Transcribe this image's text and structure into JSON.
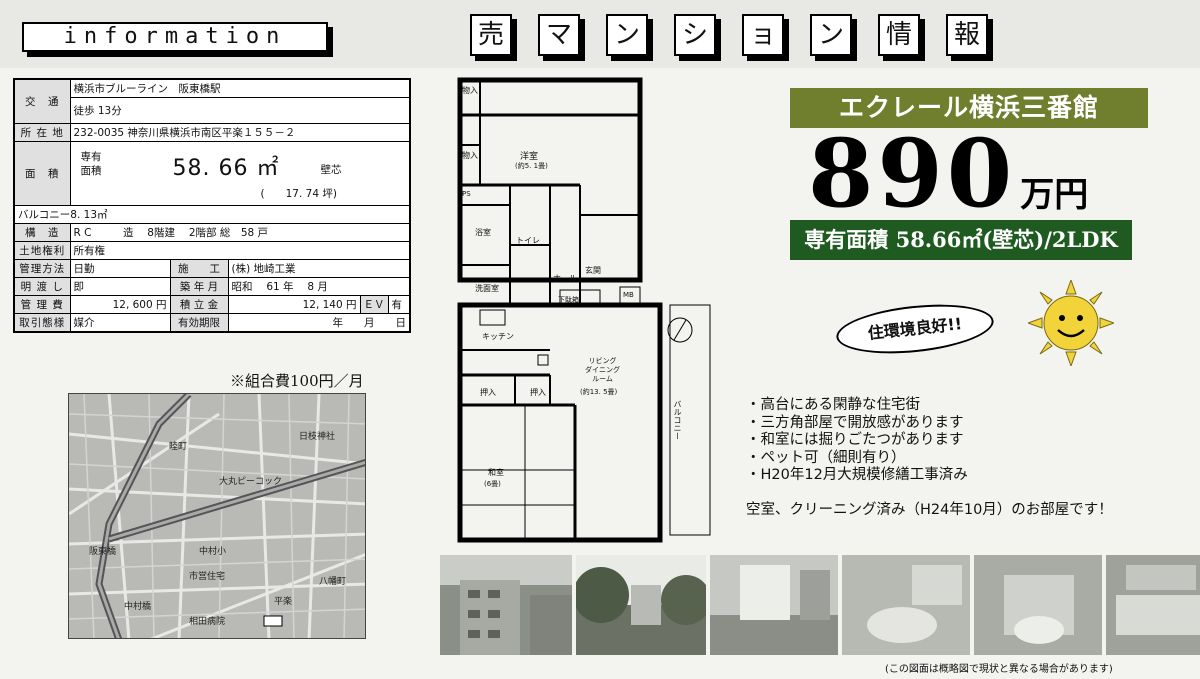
{
  "header": {
    "info_label": "information",
    "title_chars": [
      "売",
      "マ",
      "ン",
      "シ",
      "ョ",
      "ン",
      "情",
      "報"
    ]
  },
  "table": {
    "access_label": "交　通",
    "access_line1": "横浜市ブルーライン　阪東橋駅",
    "access_line2": "徒歩 13分",
    "address_label": "所 在 地",
    "address_value": "232-0035 神奈川県横浜市南区平楽１５５－２",
    "area_label": "面　積",
    "area_sub_label1": "専有",
    "area_sub_label2": "面積",
    "area_value": "58. 66 ㎡",
    "area_wall": "壁芯",
    "area_tsubo": "(　　17. 74 坪)",
    "balcony": "バルコニー8. 13㎡",
    "structure_label": "構　造",
    "structure_value": "R C　　　造　 8階建　 2階部 総　58 戸",
    "land_label": "土地権利",
    "land_value": "所有権",
    "mgmt_method_label": "管理方法",
    "mgmt_method_value": "日勤",
    "builder_label": "施　　工",
    "builder_value": "(株) 地崎工業",
    "handover_label": "明 渡 し",
    "handover_value": "即",
    "built_label": "築 年 月",
    "built_value": "昭和　 61 年　 8 月",
    "mgmt_fee_label": "管 理 費",
    "mgmt_fee_value": "12, 600 円",
    "reserve_label": "積 立 金",
    "reserve_value": "12, 140 円",
    "elevator_label": "ＥＶ",
    "elevator_value": "有",
    "deal_label": "取引態様",
    "deal_value": "媒介",
    "valid_label": "有効期限",
    "valid_value": "年　　月　　日"
  },
  "union_note": "※組合費100円／月",
  "map_labels": [
    "阪東橋",
    "大丸ピーコック",
    "中村小",
    "中村橋",
    "平楽",
    "日枝神社",
    "睦町",
    "市営住宅",
    "八幡町",
    "相田病院"
  ],
  "floorplan_labels": {
    "western_room": "洋室",
    "western_room_size": "(約5. 1畳)",
    "storage": "物入",
    "toilet": "トイレ",
    "bath": "浴室",
    "washroom": "洗面室",
    "hall": "ホール",
    "entrance": "玄関",
    "shoe_box": "下駄箱",
    "kitchen": "キッチン",
    "living": "リビング\nダイニング\nルーム",
    "living_size": "(約13. 5畳)",
    "japanese_room": "和室",
    "japanese_room_size": "(6畳)",
    "closet": "押入",
    "balcony": "バルコニー",
    "mb": "MB",
    "ps": "PS"
  },
  "property": {
    "name": "エクレール横浜三番館",
    "price": "890",
    "price_unit": "万円",
    "area_banner": "専有面積  58.66㎡(壁芯)/2LDK",
    "environment": "住環境良好!!",
    "features": [
      "高台にある閑静な住宅街",
      "三方角部屋で開放感があります",
      "和室には掘りごたつがあります",
      "ペット可（細則有り）",
      "H20年12月大規模修繕工事済み"
    ],
    "vacancy": "空室、クリーニング済み（H24年10月）のお部屋です！",
    "disclaimer": "(この図面は概略図で現状と異なる場合があります)"
  },
  "colors": {
    "name_banner": "#6f7f2d",
    "area_banner": "#1f5a20",
    "sun": "#f2d43a"
  }
}
